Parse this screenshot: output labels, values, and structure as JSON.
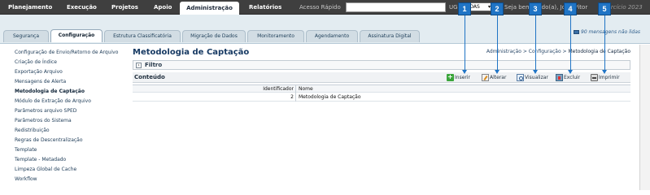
{
  "topnav": {
    "items": [
      "Planejamento",
      "Execução",
      "Projetos",
      "Apoio",
      "Administração",
      "Relatórios"
    ],
    "active": "Administração",
    "quick_access_label": "Acesso Rápido",
    "quick_access_value": "",
    "ug_label": "UG",
    "ug_value": "TODAS",
    "welcome": "Seja bem-vindo(a), Joao Vitor",
    "exercise": "Exercício 2023"
  },
  "subtabs": {
    "items": [
      "Segurança",
      "Configuração",
      "Estrutura Classificatória",
      "Migração de Dados",
      "Monitoramento",
      "Agendamento",
      "Assinatura Digital"
    ],
    "active": "Configuração",
    "messages": "90 mensagens não lidas"
  },
  "sidebar": {
    "items": [
      "Configuração de Envio/Retorno de Arquivo",
      "Criação de Índice",
      "Exportação Arquivo",
      "Mensagens de Alerta",
      "Metodologia de Captação",
      "Módulo de Extração de Arquivo",
      "Parâmetros arquivo SPED",
      "Parâmetros do Sistema",
      "Redistribuição",
      "Regras de Descentralização",
      "Template",
      "Template - Metadado",
      "Limpeza Global de Cache",
      "Workflow"
    ],
    "selected": "Metodologia de Captação"
  },
  "main": {
    "title": "Metodologia de Captação",
    "breadcrumb": {
      "part1": "Administração",
      "sep1": " > ",
      "part2": "Configuração",
      "sep2": " > ",
      "current": "Metodologia de Captação"
    },
    "filter_label": "Filtro",
    "content_label": "Conteúdo",
    "toolbar": {
      "insert": "Inserir",
      "edit": "Alterar",
      "view": "Visualizar",
      "delete": "Excluir",
      "print": "Imprimir"
    },
    "table": {
      "headers": [
        "Identificador",
        "Nome"
      ],
      "rows": [
        [
          "2",
          "Metodologia de Captação"
        ]
      ]
    }
  },
  "callouts": [
    "1",
    "2",
    "3",
    "4",
    "5"
  ],
  "colors": {
    "topbar": "#3f3f3f",
    "callout": "#1f74c5",
    "title": "#173a63"
  }
}
